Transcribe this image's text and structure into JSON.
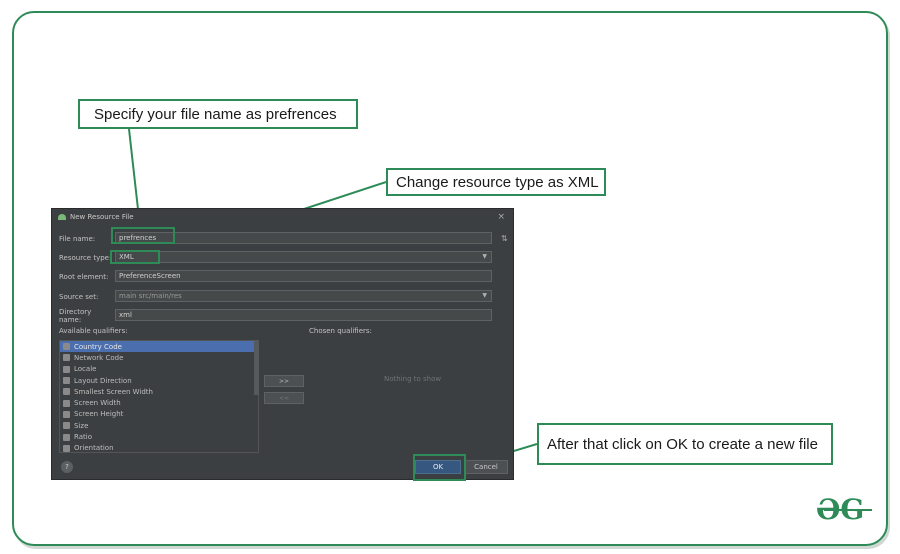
{
  "callouts": {
    "filename": "Specify your file name as prefrences",
    "restype": "Change resource type as XML",
    "ok": "After that click on OK to create a new file"
  },
  "dialog": {
    "title": "New Resource File",
    "close": "×",
    "fields": {
      "file_name_label": "File name:",
      "file_name_value": "prefrences",
      "resource_type_label": "Resource type:",
      "resource_type_value": "XML",
      "root_element_label": "Root element:",
      "root_element_value": "PreferenceScreen",
      "source_set_label": "Source set:",
      "source_set_value": "main src/main/res",
      "directory_label": "Directory name:",
      "directory_value": "xml"
    },
    "available_label": "Available qualifiers:",
    "chosen_label": "Chosen qualifiers:",
    "qualifiers": [
      "Country Code",
      "Network Code",
      "Locale",
      "Layout Direction",
      "Smallest Screen Width",
      "Screen Width",
      "Screen Height",
      "Size",
      "Ratio",
      "Orientation"
    ],
    "add_button": ">>",
    "remove_button": "<<",
    "nothing_to_show": "Nothing to show",
    "help": "?",
    "ok": "OK",
    "cancel": "Cancel"
  },
  "logo": "ƏG"
}
